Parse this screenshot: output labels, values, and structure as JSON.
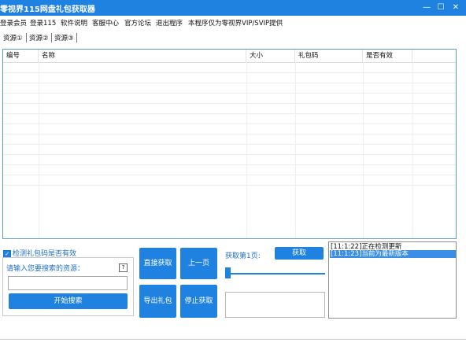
{
  "window": {
    "title": "零视界115网盘礼包获取器",
    "minimize_glyph": "—",
    "maximize_glyph": "☐",
    "close_glyph": "✕"
  },
  "menu": [
    "登录会员",
    "登录115",
    "软件说明",
    "客服中心",
    "官方论坛",
    "退出程序",
    "本程序仅为零视界VIP/SVIP提供"
  ],
  "tabs": [
    "资源①",
    "资源②",
    "资源③"
  ],
  "table": {
    "columns": [
      "编号",
      "名称",
      "大小",
      "礼包码",
      "是否有效"
    ],
    "rows": []
  },
  "checkbox": {
    "label": "检测礼包码是否有效",
    "checked": true
  },
  "search": {
    "label": "请输入您要搜索的资源：",
    "help_glyph": "?",
    "value": "",
    "button": "开始搜索"
  },
  "actions": {
    "direct_fetch": "直接获取",
    "prev_page": "上一页",
    "export_gift": "导出礼包",
    "stop_fetch": "停止获取"
  },
  "page": {
    "label": "获取第1页:",
    "fetch_button": "获取",
    "slider_level": 0
  },
  "log": [
    {
      "text": "[11:1:22]正在检测更新",
      "selected": false
    },
    {
      "text": "[11:1:23]当前为最新版本",
      "selected": true
    }
  ],
  "colors": {
    "accent": "#1f82e0",
    "label": "#1f6fc8"
  }
}
